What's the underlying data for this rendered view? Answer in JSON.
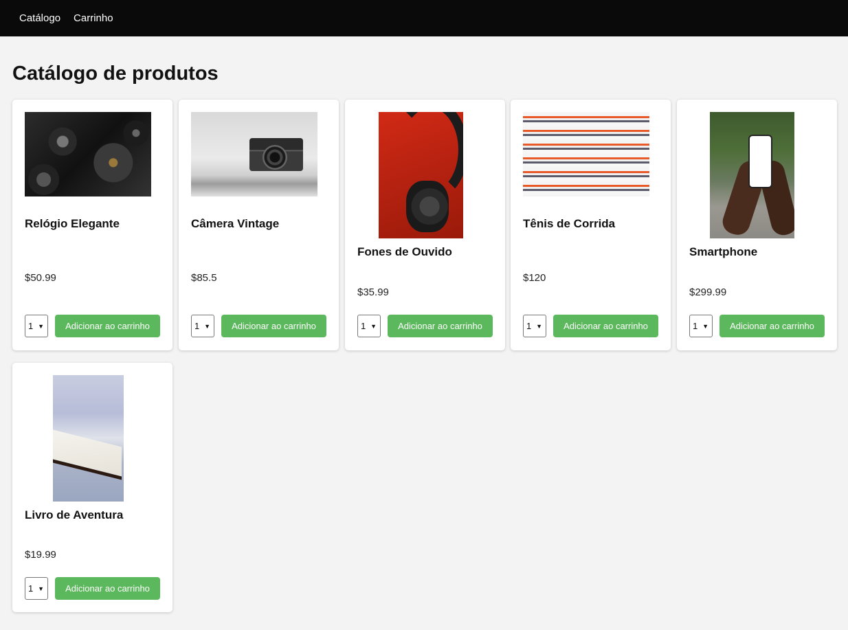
{
  "nav": {
    "items": [
      "Catálogo",
      "Carrinho"
    ]
  },
  "page": {
    "title": "Catálogo de produtos"
  },
  "products": [
    {
      "name": "Relógio Elegante",
      "price": "$50.99",
      "qty": "1",
      "button": "Adicionar ao carrinho",
      "image": "watch-gears-image"
    },
    {
      "name": "Câmera Vintage",
      "price": "$85.5",
      "qty": "1",
      "button": "Adicionar ao carrinho",
      "image": "vintage-camera-image"
    },
    {
      "name": "Fones de Ouvido",
      "price": "$35.99",
      "qty": "1",
      "button": "Adicionar ao carrinho",
      "image": "headphones-image"
    },
    {
      "name": "Tênis de Corrida",
      "price": "$120",
      "qty": "1",
      "button": "Adicionar ao carrinho",
      "image": "running-shoes-image"
    },
    {
      "name": "Smartphone",
      "price": "$299.99",
      "qty": "1",
      "button": "Adicionar ao carrinho",
      "image": "smartphone-image"
    },
    {
      "name": "Livro de Aventura",
      "price": "$19.99",
      "qty": "1",
      "button": "Adicionar ao carrinho",
      "image": "book-image"
    }
  ],
  "colors": {
    "navbar": "#0a0a0a",
    "button": "#5cb85c",
    "background": "#f3f3f3"
  }
}
